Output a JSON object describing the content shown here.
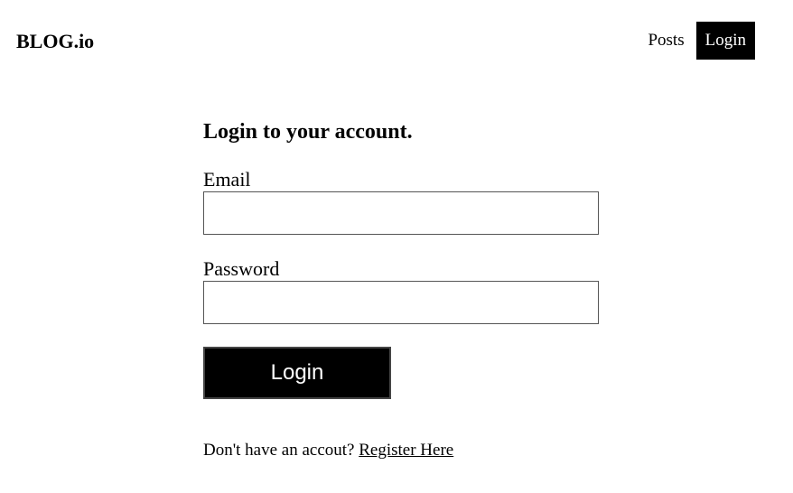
{
  "header": {
    "brand": "BLOG.io",
    "nav": {
      "posts_label": "Posts",
      "login_label": "Login"
    }
  },
  "login_form": {
    "title": "Login to your account.",
    "email_label": "Email",
    "email_value": "",
    "password_label": "Password",
    "password_value": "",
    "submit_label": "Login",
    "register_prompt": "Don't have an accout?",
    "register_link": "Register Here"
  },
  "colors": {
    "background": "#ffffff",
    "text": "#000000",
    "button_bg": "#000000",
    "button_text": "#ffffff",
    "input_border": "#555555"
  }
}
